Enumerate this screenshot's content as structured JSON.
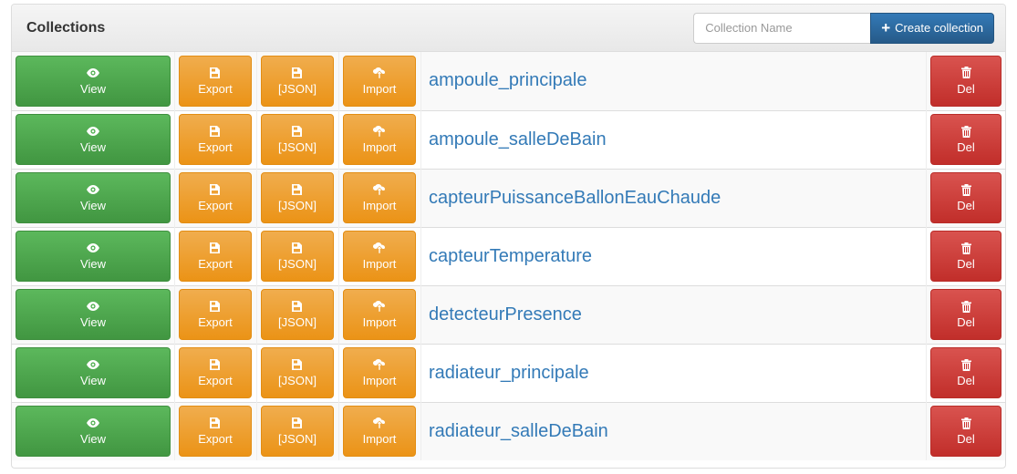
{
  "panel": {
    "title": "Collections",
    "input_placeholder": "Collection Name",
    "create_label": "Create collection"
  },
  "buttons": {
    "view": "View",
    "export": "Export",
    "json": "[JSON]",
    "import": "Import",
    "del": "Del"
  },
  "icons": {
    "view": "eye-icon",
    "export": "save-file-icon",
    "json": "save-file-icon",
    "import": "upload-icon",
    "del": "trash-icon",
    "create": "plus-icon"
  },
  "colors": {
    "view": "#5cb85c",
    "export": "#f0ad4e",
    "del": "#d9534f",
    "primary": "#337ab7"
  },
  "collections": [
    "ampoule_principale",
    "ampoule_salleDeBain",
    "capteurPuissanceBallonEauChaude",
    "capteurTemperature",
    "detecteurPresence",
    "radiateur_principale",
    "radiateur_salleDeBain"
  ]
}
